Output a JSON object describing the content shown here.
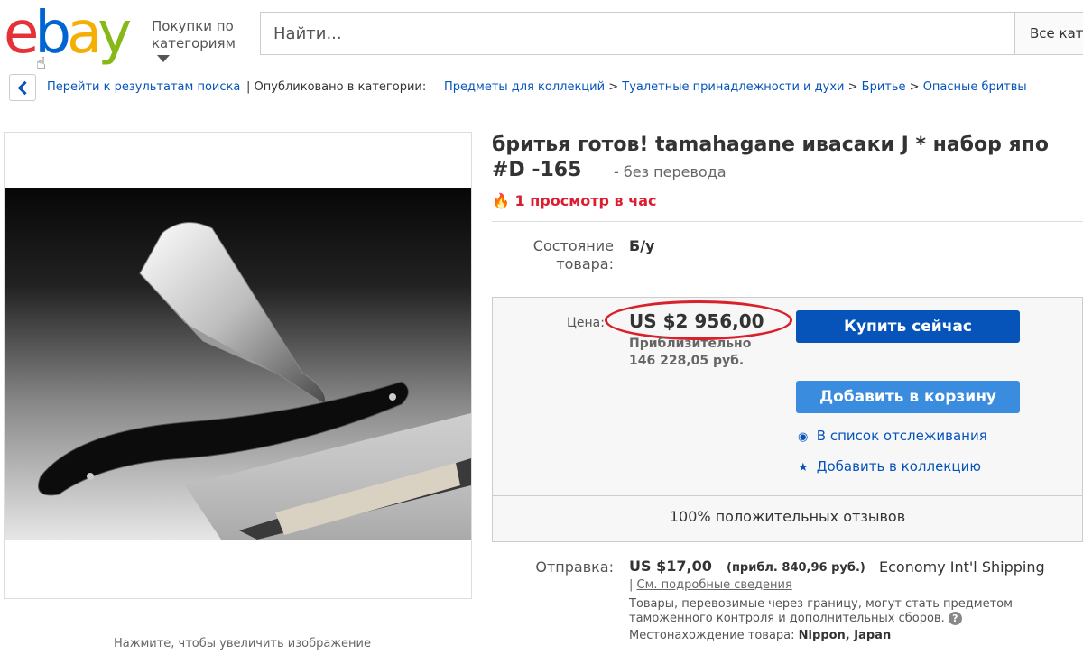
{
  "header": {
    "logo": [
      "e",
      "b",
      "a",
      "y"
    ],
    "shop_by_category": "Покупки по категориям",
    "search_placeholder": "Найти...",
    "category_select": "Все кате"
  },
  "breadcrumb": {
    "back_to_results": "Перейти к результатам поиска",
    "published_in": "| Опубликовано в категории:",
    "items": [
      "Предметы для коллекций",
      "Туалетные принадлежности и духи",
      "Бритье",
      "Опасные бритвы"
    ],
    "separator": ">"
  },
  "item": {
    "title_line1": "бритья готов! tamahagane ивасаки J * набор япо",
    "title_line2": "#D -165",
    "title_dash": "-",
    "no_translation": "без перевода",
    "views": "1 просмотр в час",
    "condition_label": "Состояние товара:",
    "condition_value": "Б/у",
    "enlarge_hint": "Нажмите, чтобы увеличить изображение"
  },
  "pricing": {
    "price_label": "Цена:",
    "price": "US $2 956,00",
    "approx_label": "Приблизительно",
    "approx_value": "146 228,05 руб.",
    "buy_now": "Купить сейчас",
    "add_to_cart": "Добавить в корзину",
    "watchlist": "В список отслеживания",
    "add_collection": "Добавить в коллекцию",
    "feedback": "100% положительных отзывов"
  },
  "shipping": {
    "label": "Отправка:",
    "price": "US $17,00",
    "approx": "(прибл. 840,96 руб.)",
    "method": "Economy Int'l Shipping",
    "details_prefix": "|",
    "details_link": "См. подробные сведения",
    "customs_note": "Товары, перевозимые через границу, могут стать предметом таможенного контроля и дополнительных сборов.",
    "location_label": "Местонахождение товара:",
    "location_value": "Nippon, Japan"
  },
  "colors": {
    "ebay_blue": "#0654ba",
    "views_red": "#dd1e31",
    "oval_red": "#d8212b"
  },
  "icons": [
    "cursor-hand-icon",
    "chevron-down-icon",
    "chevron-left-icon",
    "flame-icon",
    "eye-icon",
    "star-icon",
    "question-icon"
  ]
}
